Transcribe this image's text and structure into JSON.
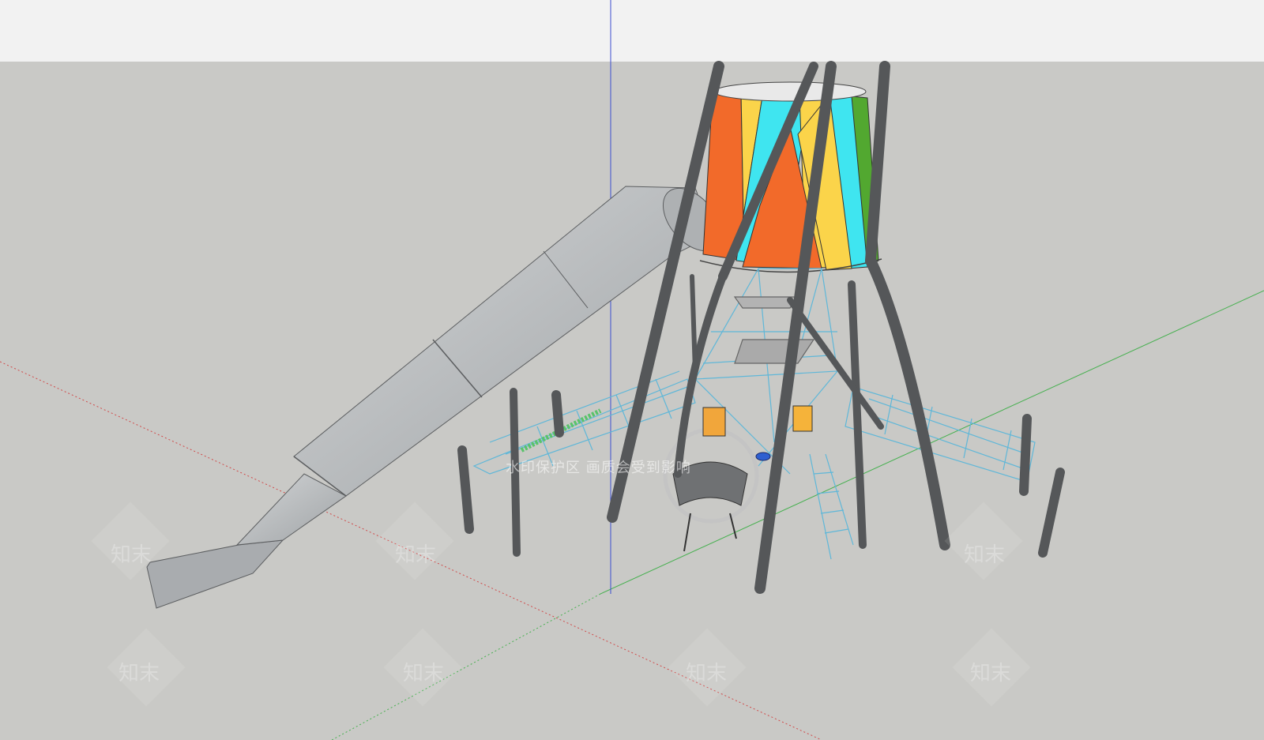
{
  "viewport": {
    "name": "3D modeling viewport",
    "sky_color": "#f2f2f2",
    "ground_color": "#c9c9c6"
  },
  "colors": {
    "tube_slide": "#b8bbbd",
    "post": "#555759",
    "rope_net": "#5fb7d8",
    "panel_orange": "#f26a2a",
    "panel_yellow": "#fbd44a",
    "panel_cyan": "#3fe5f0",
    "panel_green": "#52a830",
    "axis_red": "#d04a4a",
    "axis_green": "#47b050",
    "axis_blue": "#3d4fd0"
  },
  "watermark": {
    "text": "水印保护区  画质会受到影响",
    "logo_text": "知末"
  },
  "model": {
    "components": [
      "tower",
      "tube-slide",
      "rope-net-left",
      "rope-net-right",
      "hoop-climber",
      "rope-ladder",
      "support-posts"
    ]
  }
}
